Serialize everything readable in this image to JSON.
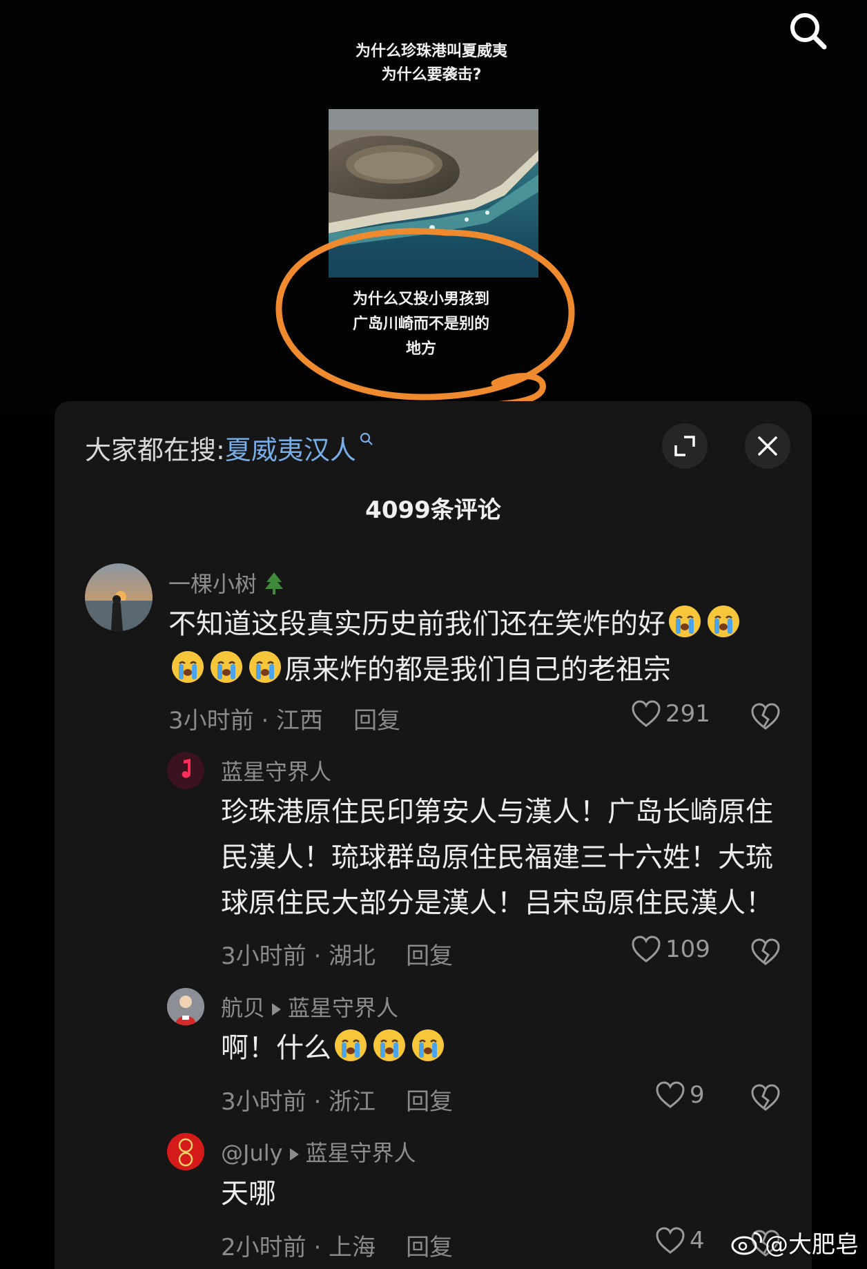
{
  "video": {
    "caption_top_line1": "为什么珍珠港叫夏威夷",
    "caption_top_line2": "为什么要袭击?",
    "caption_mid_line1": "为什么又投小男孩到",
    "caption_mid_line2": "广岛川崎而不是别的",
    "caption_mid_line3": "地方",
    "annotation_color": "#f08a2e"
  },
  "panel": {
    "search_prefix": "大家都在搜:",
    "search_term": "夏威夷汉人",
    "comment_count": "4099条评论"
  },
  "comments": [
    {
      "username": "一棵小树",
      "text_line1": "不知道这段真实历史前我们还在笑炸的好",
      "text_line2": "原来炸的都是我们自己的老祖宗",
      "time_loc": "3小时前 · 江西",
      "reply": "回复",
      "likes": "291"
    },
    {
      "username": "蓝星守界人",
      "text_line1": "珍珠港原住民印第安人与漢人！广岛长崎原住",
      "text_line2": "民漢人！琉球群岛原住民福建三十六姓！大琉",
      "text_line3": "球原住民大部分是漢人！吕宋岛原住民漢人！",
      "time_loc": "3小时前 · 湖北",
      "reply": "回复",
      "likes": "109"
    },
    {
      "username": "航贝",
      "reply_to": "蓝星守界人",
      "text": "啊！什么",
      "time_loc": "3小时前 · 浙江",
      "reply": "回复",
      "likes": "9"
    },
    {
      "username": "@July",
      "reply_to": "蓝星守界人",
      "text": "天哪",
      "time_loc": "2小时前 · 上海",
      "reply": "回复",
      "likes": "4"
    }
  ],
  "watermark": "@大肥皂",
  "colors": {
    "panel_bg": "#161616",
    "link_blue": "#78aee8",
    "muted_text": "#8a8a8a"
  }
}
